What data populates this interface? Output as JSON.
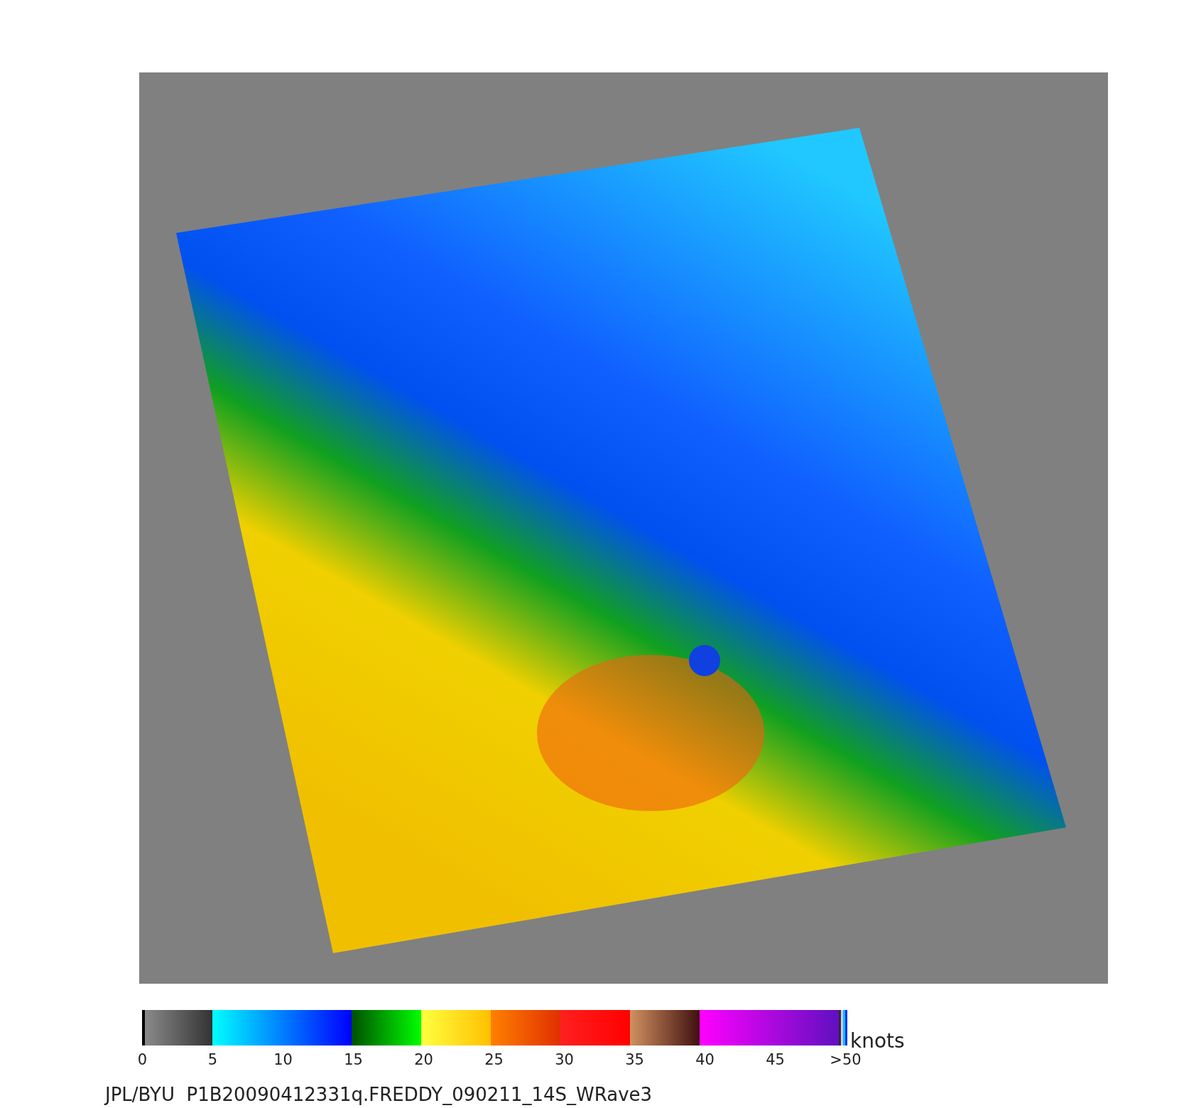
{
  "colorbar": {
    "ticks": [
      "0",
      "5",
      "10",
      "15",
      "20",
      "25",
      "30",
      "35",
      "40",
      "45",
      ">50"
    ],
    "unit": "knots"
  },
  "caption": "JPL/BYU  P1B20090412331q.FREDDY_090211_14S_WRave3"
}
